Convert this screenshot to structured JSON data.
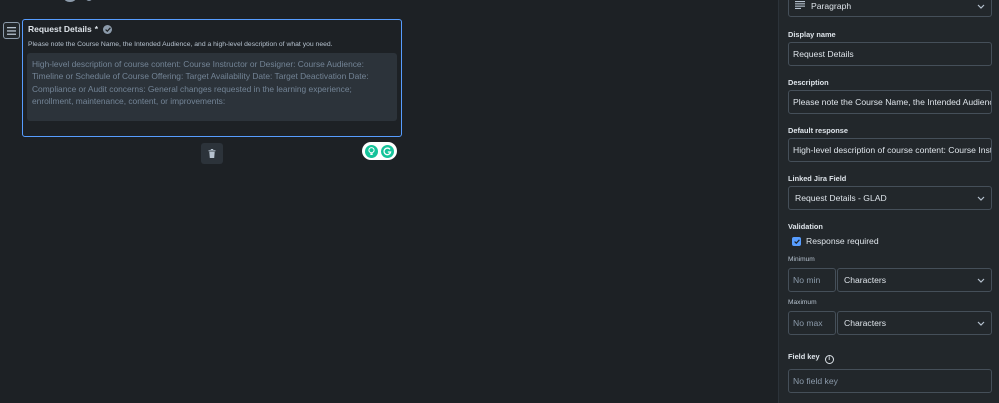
{
  "canvas": {
    "field": {
      "title": "Request Details",
      "required_mark": "*",
      "description": "Please note the Course Name, the Intended Audience, and a high-level description of what you need.",
      "placeholder_lines": [
        "High-level description of course content: Course Instructor or Designer: Course Audience:",
        "Timeline or Schedule of Course Offering: Target Availability Date: Target Deactivation Date:",
        "Compliance or Audit concerns: General changes requested in the learning experience;",
        "enrollment, maintenance, content, or improvements:"
      ]
    }
  },
  "panel": {
    "field_type": "Paragraph",
    "display_name": {
      "label": "Display name",
      "value": "Request Details"
    },
    "description": {
      "label": "Description",
      "value": "Please note the Course Name, the Intended Audience, and a high-level description of what you need."
    },
    "default_response": {
      "label": "Default response",
      "value": "High-level description of course content: Course Instructor or Designer: Course Audience:"
    },
    "linked_jira": {
      "label": "Linked Jira Field",
      "value": "Request Details - GLAD"
    },
    "validation": {
      "label": "Validation",
      "response_required": "Response required",
      "minimum_label": "Minimum",
      "minimum_placeholder": "No min",
      "minimum_unit": "Characters",
      "maximum_label": "Maximum",
      "maximum_placeholder": "No max",
      "maximum_unit": "Characters"
    },
    "field_key": {
      "label": "Field key",
      "placeholder": "No field key"
    }
  },
  "colors": {
    "accent": "#579dff",
    "background": "#1d2125",
    "panel": "#22272b",
    "assistant": "#15c39a"
  },
  "icons": [
    "drag-handle-icon",
    "verified-check-icon",
    "trash-icon",
    "lightbulb-icon",
    "grammarly-icon",
    "paragraph-icon",
    "chevron-down-icon",
    "info-icon",
    "checkmark-icon"
  ]
}
